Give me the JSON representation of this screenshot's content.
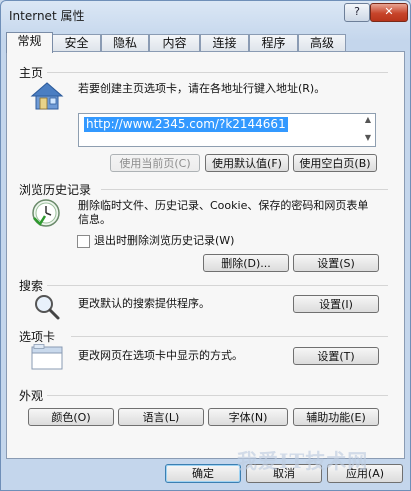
{
  "window": {
    "title": "Internet 属性",
    "help_label": "?",
    "close_label": "✕"
  },
  "tabs": [
    {
      "label": "常规",
      "active": true
    },
    {
      "label": "安全",
      "active": false
    },
    {
      "label": "隐私",
      "active": false
    },
    {
      "label": "内容",
      "active": false
    },
    {
      "label": "连接",
      "active": false
    },
    {
      "label": "程序",
      "active": false
    },
    {
      "label": "高级",
      "active": false
    }
  ],
  "homepage": {
    "section_label": "主页",
    "instruction": "若要创建主页选项卡，请在各地址行键入地址(R)。",
    "url_value": "http://www.2345.com/?k2144661",
    "use_current_label": "使用当前页(C)",
    "use_default_label": "使用默认值(F)",
    "use_blank_label": "使用空白页(B)"
  },
  "history": {
    "section_label": "浏览历史记录",
    "description": "删除临时文件、历史记录、Cookie、保存的密码和网页表单信息。",
    "checkbox_label": "退出时删除浏览历史记录(W)",
    "delete_label": "删除(D)...",
    "settings_label": "设置(S)"
  },
  "search": {
    "section_label": "搜索",
    "description": "更改默认的搜索提供程序。",
    "settings_label": "设置(I)"
  },
  "tabs_section": {
    "section_label": "选项卡",
    "description": "更改网页在选项卡中显示的方式。",
    "settings_label": "设置(T)"
  },
  "appearance": {
    "section_label": "外观",
    "colors_label": "颜色(O)",
    "languages_label": "语言(L)",
    "fonts_label": "字体(N)",
    "accessibility_label": "辅助功能(E)"
  },
  "footer": {
    "ok_label": "确定",
    "cancel_label": "取消",
    "apply_label": "应用(A)"
  },
  "watermark": {
    "text": "我爱IT技术网"
  }
}
